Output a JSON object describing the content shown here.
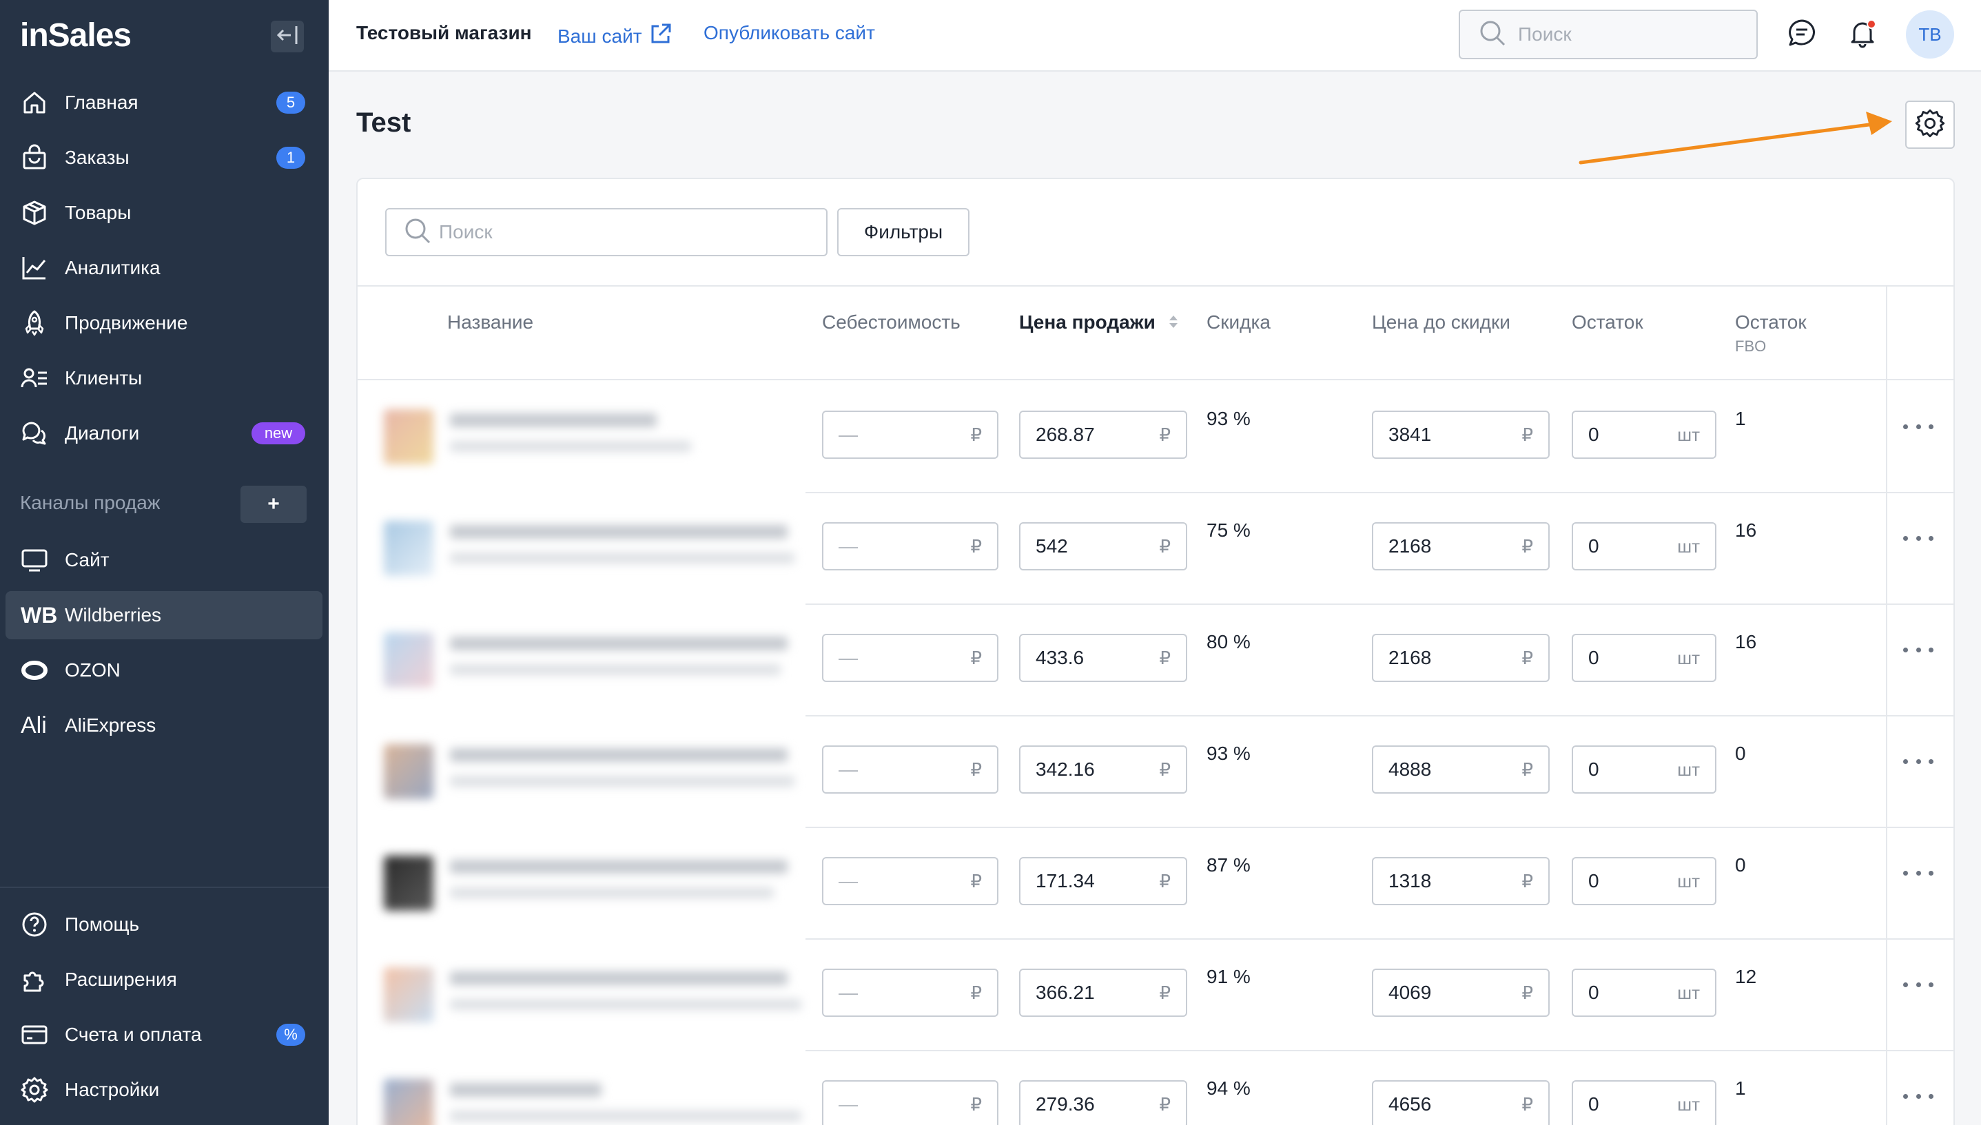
{
  "app": {
    "logo": "inSales",
    "brand_color": "#263345",
    "accent_color": "#2f6fd6"
  },
  "sidebar": {
    "collapse_icon": "collapse-left-icon",
    "items": [
      {
        "label": "Главная",
        "icon": "home-icon",
        "badge": "5"
      },
      {
        "label": "Заказы",
        "icon": "shopping-bag-icon",
        "badge": "1"
      },
      {
        "label": "Товары",
        "icon": "box-icon",
        "badge": ""
      },
      {
        "label": "Аналитика",
        "icon": "chart-line-icon",
        "badge": ""
      },
      {
        "label": "Продвижение",
        "icon": "rocket-icon",
        "badge": ""
      },
      {
        "label": "Клиенты",
        "icon": "users-list-icon",
        "badge": ""
      },
      {
        "label": "Диалоги",
        "icon": "chat-bubbles-icon",
        "badge": "new"
      }
    ],
    "channels_title": "Каналы продаж",
    "channels_add": "+",
    "channels": [
      {
        "label": "Сайт",
        "icon": "monitor-icon",
        "icon_text": ""
      },
      {
        "label": "Wildberries",
        "icon": "wb-icon",
        "icon_text": "WB",
        "active": true
      },
      {
        "label": "OZON",
        "icon": "ozon-icon",
        "icon_text": ""
      },
      {
        "label": "AliExpress",
        "icon": "ali-icon",
        "icon_text": "Ali"
      }
    ],
    "bottom": [
      {
        "label": "Помощь",
        "icon": "help-icon",
        "badge": ""
      },
      {
        "label": "Расширения",
        "icon": "puzzle-icon",
        "badge": ""
      },
      {
        "label": "Счета и оплата",
        "icon": "credit-card-icon",
        "badge": "%"
      },
      {
        "label": "Настройки",
        "icon": "gear-icon",
        "badge": ""
      }
    ]
  },
  "header": {
    "store_name": "Тестовый магазин",
    "your_site": "Ваш сайт",
    "publish_site": "Опубликовать сайт",
    "search_placeholder": "Поиск",
    "avatar_initials": "ТВ"
  },
  "page": {
    "title": "Test",
    "search_placeholder": "Поиск",
    "filters_label": "Фильтры"
  },
  "table": {
    "columns": {
      "name": "Название",
      "cost": "Себестоимость",
      "price": "Цена продажи",
      "discount": "Скидка",
      "price_before": "Цена до скидки",
      "stock": "Остаток",
      "stock_fbo": "Остаток",
      "stock_fbo_sub": "FBO"
    },
    "currency": "₽",
    "unit": "шт",
    "empty_value": "—",
    "rows": [
      {
        "cost": "—",
        "price": "268.87",
        "discount": "93 %",
        "price_before": "3841",
        "stock": "0",
        "stock_fbo": "1"
      },
      {
        "cost": "—",
        "price": "542",
        "discount": "75 %",
        "price_before": "2168",
        "stock": "0",
        "stock_fbo": "16"
      },
      {
        "cost": "—",
        "price": "433.6",
        "discount": "80 %",
        "price_before": "2168",
        "stock": "0",
        "stock_fbo": "16"
      },
      {
        "cost": "—",
        "price": "342.16",
        "discount": "93 %",
        "price_before": "4888",
        "stock": "0",
        "stock_fbo": "0"
      },
      {
        "cost": "—",
        "price": "171.34",
        "discount": "87 %",
        "price_before": "1318",
        "stock": "0",
        "stock_fbo": "0"
      },
      {
        "cost": "—",
        "price": "366.21",
        "discount": "91 %",
        "price_before": "4069",
        "stock": "0",
        "stock_fbo": "12"
      },
      {
        "cost": "—",
        "price": "279.36",
        "discount": "94 %",
        "price_before": "4656",
        "stock": "0",
        "stock_fbo": "1"
      }
    ]
  }
}
